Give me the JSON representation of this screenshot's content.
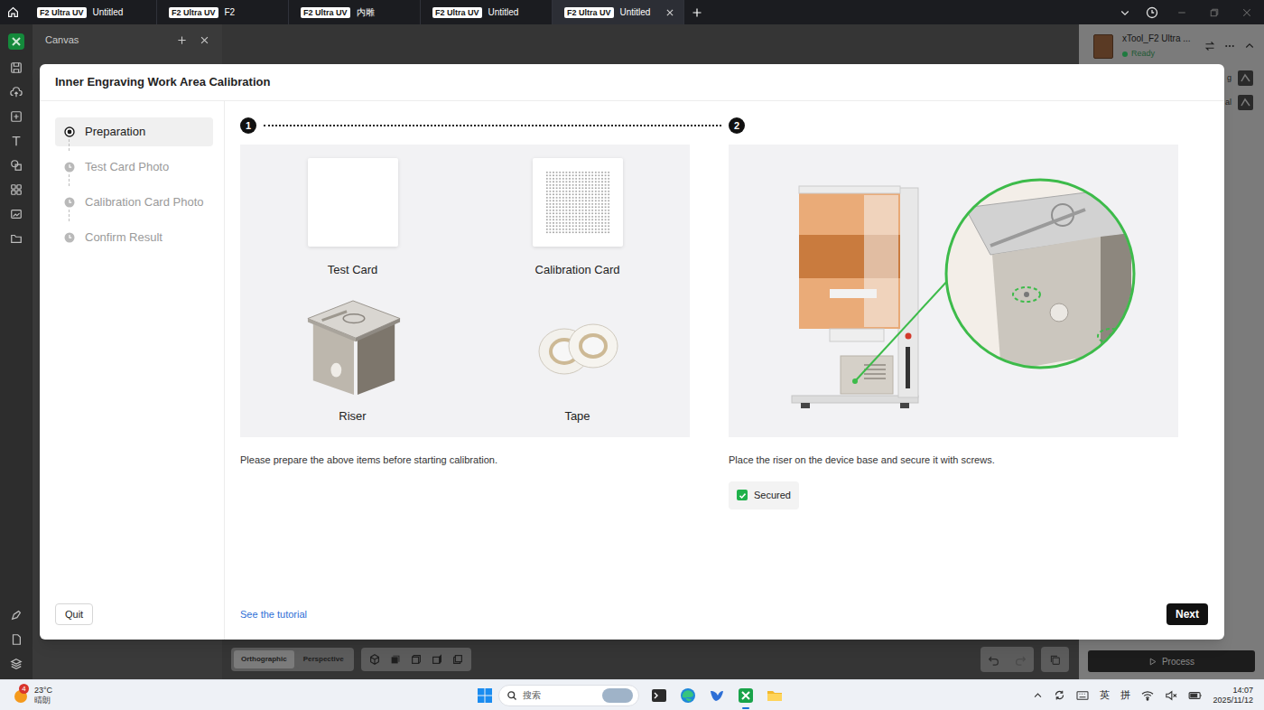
{
  "titlebar": {
    "tabs": [
      {
        "badge": "F2 Ultra UV",
        "title": "Untitled",
        "selected": false
      },
      {
        "badge": "F2 Ultra UV",
        "title": "F2",
        "selected": false
      },
      {
        "badge": "F2 Ultra UV",
        "title": "内雕",
        "selected": false
      },
      {
        "badge": "F2 Ultra UV",
        "title": "Untitled",
        "selected": false
      },
      {
        "badge": "F2 Ultra UV",
        "title": "Untitled",
        "selected": true
      }
    ]
  },
  "app": {
    "panel": {
      "title": "Canvas"
    },
    "device": {
      "name": "xTool_F2 Ultra ...",
      "status": "Ready"
    },
    "settings": [
      {
        "label": "g"
      },
      {
        "label": "al"
      }
    ],
    "view_modes": [
      {
        "label": "Orthographic",
        "selected": true
      },
      {
        "label": "Perspective",
        "selected": false
      }
    ],
    "process": "Process"
  },
  "dialog": {
    "title": "Inner Engraving Work Area Calibration",
    "steps": [
      {
        "label": "Preparation",
        "selected": true
      },
      {
        "label": "Test Card Photo",
        "selected": false
      },
      {
        "label": "Calibration Card Photo",
        "selected": false
      },
      {
        "label": "Confirm Result",
        "selected": false
      }
    ],
    "quit": "Quit",
    "stepper": [
      {
        "number": "1"
      },
      {
        "number": "2"
      }
    ],
    "items": [
      {
        "label": "Test Card",
        "kind": "card"
      },
      {
        "label": "Calibration Card",
        "kind": "dot-card"
      },
      {
        "label": "Riser",
        "kind": "riser"
      },
      {
        "label": "Tape",
        "kind": "tape"
      }
    ],
    "prepare_text": "Please prepare the above items before starting calibration.",
    "riser_text": "Place the riser on the device base and secure it with screws.",
    "secured": {
      "label": "Secured",
      "checked": true
    },
    "tutorial": "See the tutorial",
    "next": "Next"
  },
  "taskbar": {
    "weather": {
      "temperature": "23°C",
      "condition": "晴朗",
      "badge": "4"
    },
    "search": {
      "placeholder": "搜索"
    },
    "apps": [
      {
        "kind": "terminal",
        "active": false
      },
      {
        "kind": "edge",
        "active": false
      },
      {
        "kind": "bird",
        "active": false
      },
      {
        "kind": "xtool",
        "active": true
      },
      {
        "kind": "folder",
        "active": false
      }
    ],
    "tray": {
      "input_lang": "英",
      "input_mode": "拼",
      "time": "14:07",
      "date": "2025/11/12"
    }
  }
}
